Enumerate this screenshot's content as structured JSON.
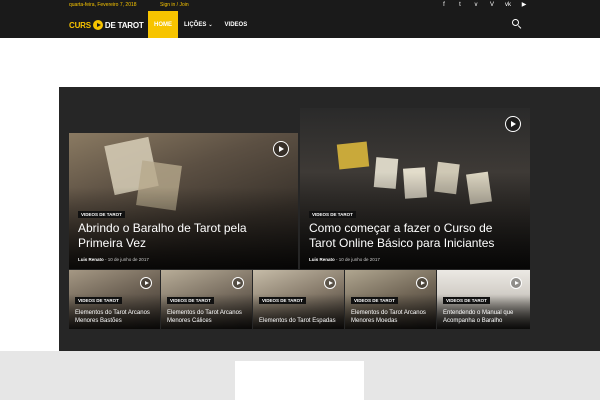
{
  "topbar": {
    "date": "quarta-feira, Fevereiro 7, 2018",
    "signin": "Sign in / Join",
    "social_icons": [
      "facebook-icon",
      "twitter-icon",
      "vimeo-icon",
      "vine-icon",
      "vk-icon",
      "youtube-icon"
    ]
  },
  "header": {
    "logo_word1": "CURS",
    "logo_word2": "DE TAROT",
    "nav": [
      {
        "label": "HOME",
        "active": true
      },
      {
        "label": "LIÇÕES",
        "dropdown": true
      },
      {
        "label": "VIDEOS"
      }
    ]
  },
  "colors": {
    "accent": "#f7c400",
    "dark": "#1a1a1a",
    "panel": "#262626"
  },
  "featured": {
    "big": [
      {
        "category": "VIDEOS DE TAROT",
        "title": "Abrindo o Baralho de Tarot pela Primeira Vez",
        "author": "Luis Renato",
        "date": "10 de junho de 2017"
      },
      {
        "category": "VIDEOS DE TAROT",
        "title": "Como começar a fazer o Curso de Tarot Online Básico para Iniciantes",
        "author": "Luis Renato",
        "date": "10 de junho de 2017"
      }
    ],
    "small": [
      {
        "category": "VIDEOS DE TAROT",
        "title": "Elementos do Tarot Arcanos Menores Bastões"
      },
      {
        "category": "VIDEOS DE TAROT",
        "title": "Elementos do Tarot Arcanos Menores Cálices"
      },
      {
        "category": "VIDEOS DE TAROT",
        "title": "Elementos do Tarot Espadas"
      },
      {
        "category": "VIDEOS DE TAROT",
        "title": "Elementos do Tarot Arcanos Menores Moedas"
      },
      {
        "category": "VIDEOS DE TAROT",
        "title": "Entendendo o Manual que Acompanha o Baralho"
      }
    ]
  }
}
